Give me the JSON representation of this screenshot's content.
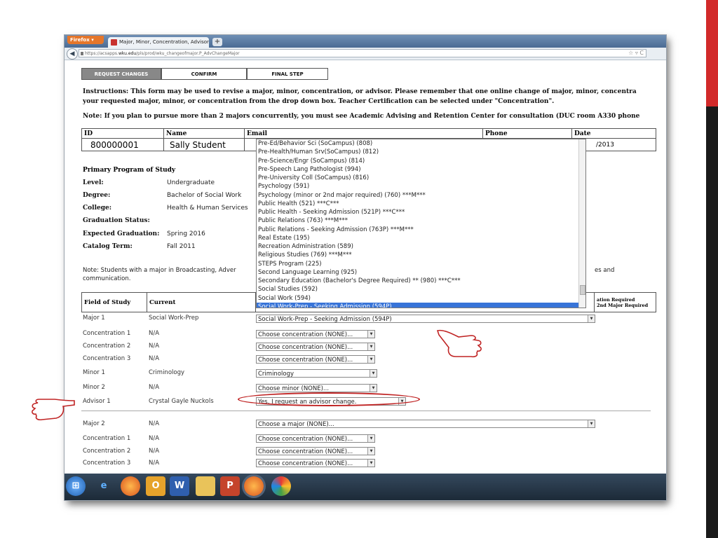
{
  "browser": {
    "menu_label": "Firefox",
    "tab_title": "Major, Minor, Concentration, Advisor C...",
    "new_tab": "+",
    "url_prefix": "https://acsapps.",
    "url_domain": "wku.edu",
    "url_path": "/pls/prod/wku_changeofmajor.P_AdvChangeMajor"
  },
  "steps": [
    "REQUEST CHANGES",
    "CONFIRM",
    "FINAL STEP"
  ],
  "instructions_line1": "Instructions: This form may be used to revise a major, minor, concentration, or advisor. Please remember that one online change of major, minor, concentra",
  "instructions_line2": "your requested major, minor, or concentration from the drop down box. Teacher Certification can be selected under \"Concentration\".",
  "note_line": "Note: If you plan to pursue more than 2 majors concurrently, you must see Academic Advising and Retention Center for consultation (DUC room A330 phone",
  "student_table": {
    "headers": [
      "ID",
      "Name",
      "Email",
      "Phone",
      "Date"
    ],
    "id": "800000001",
    "name": "Sally Student",
    "date": "/2013"
  },
  "primary": {
    "heading": "Primary Program of Study",
    "rows": [
      {
        "label": "Level:",
        "value": "Undergraduate"
      },
      {
        "label": "Degree:",
        "value": "Bachelor of Social Work"
      },
      {
        "label": "College:",
        "value": "Health & Human Services"
      },
      {
        "label": "Graduation Status:",
        "value": ""
      },
      {
        "label": "Expected Graduation:",
        "value": "Spring 2016"
      },
      {
        "label": "Catalog Term:",
        "value": "Fall 2011"
      }
    ]
  },
  "note2_line1_start": "Note: Students with a major in Broadcasting, Adver",
  "note2_line1_end": "es and",
  "note2_line2": "communication.",
  "field_headers": {
    "field": "Field of Study",
    "current": "Current",
    "req1": "ation Required",
    "req2": "2nd Major Required"
  },
  "dropdown_options": [
    "Pre-Ed/Behavior Sci (SoCampus) (808)",
    "Pre-Health/Human Srv(SoCampus) (812)",
    "Pre-Science/Engr (SoCampus) (814)",
    "Pre-Speech Lang Pathologist (994)",
    "Pre-University Coll (SoCampus) (816)",
    "Psychology (591)",
    "Psychology (minor or 2nd major required) (760) ***M***",
    "Public Health (521)   ***C***",
    "Public Health - Seeking Admission (521P)   ***C***",
    "Public Relations (763) ***M***",
    "Public Relations - Seeking Admission (763P) ***M***",
    "Real Estate (195)",
    "Recreation Administration (589)",
    "Religious Studies (769) ***M***",
    "STEPS Program (225)",
    "Second Language Learning (925)",
    "Secondary Education (Bachelor's Degree Required) ** (980)   ***C***",
    "Social Studies (592)",
    "Social Work (594)",
    "Social Work-Prep - Seeking Admission (594P)"
  ],
  "dropdown_selected_index": 19,
  "rows": [
    {
      "label": "Major 1",
      "current": "Social Work-Prep",
      "select": "Social Work-Prep - Seeking Admission (594P)"
    },
    {
      "label": "Concentration 1",
      "current": "N/A",
      "select": "Choose concentration (NONE)..."
    },
    {
      "label": "Concentration 2",
      "current": "N/A",
      "select": "Choose concentration (NONE)..."
    },
    {
      "label": "Concentration 3",
      "current": "N/A",
      "select": "Choose concentration (NONE)..."
    },
    {
      "label": "Minor 1",
      "current": "Criminology",
      "select": "Criminology"
    },
    {
      "label": "Minor 2",
      "current": "N/A",
      "select": "Choose minor (NONE)..."
    },
    {
      "label": "Advisor 1",
      "current": "Crystal Gayle Nuckols",
      "select": "Yes, I request an advisor change."
    },
    {
      "label": "Major 2",
      "current": "N/A",
      "select": "Choose a major (NONE)..."
    },
    {
      "label": "Concentration 1",
      "current": "N/A",
      "select": "Choose concentration (NONE)..."
    },
    {
      "label": "Concentration 2",
      "current": "N/A",
      "select": "Choose concentration (NONE)..."
    },
    {
      "label": "Concentration 3",
      "current": "N/A",
      "select": "Choose concentration (NONE)..."
    }
  ],
  "colors": {
    "slide_accent": "#d22a2a",
    "highlight": "#3874d8",
    "annotation": "#c02424"
  }
}
